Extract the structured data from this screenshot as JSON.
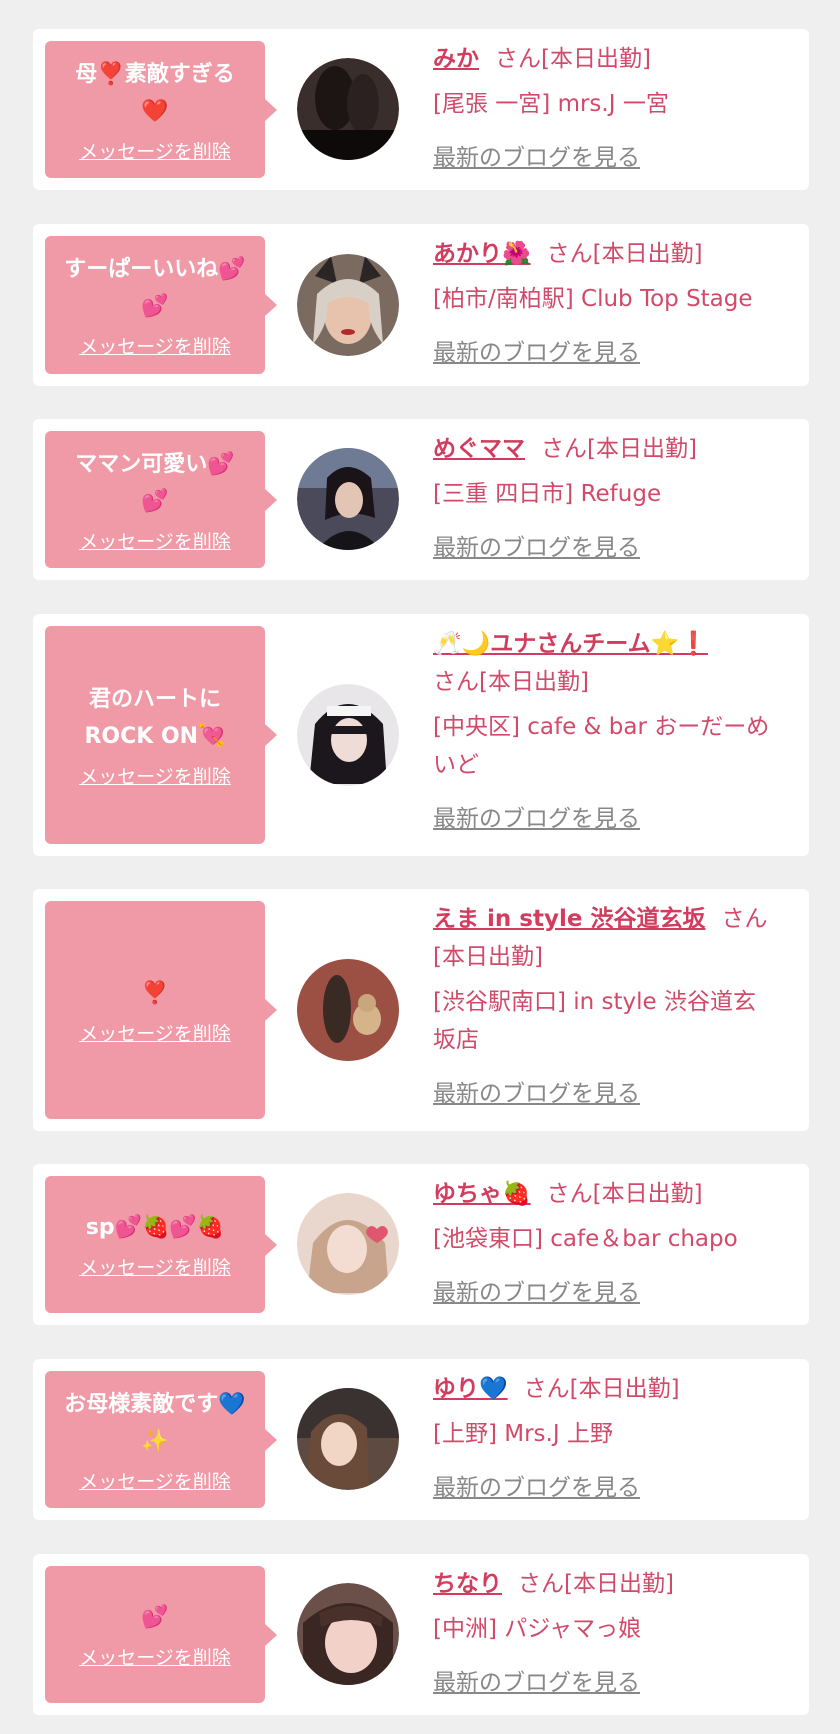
{
  "ui": {
    "delete_label": "メッセージを削除",
    "san_suffix": "さん[本日出勤]",
    "blog_label": "最新のブログを見る"
  },
  "colors": {
    "background": "#efefef",
    "card": "#ffffff",
    "bubble": "#ef9aa6",
    "name": "#d23c5e",
    "shop": "#d24a6a",
    "blog_link": "#888888"
  },
  "entries": [
    {
      "message_lines": [
        "母❣️素敵すぎる",
        "❤️"
      ],
      "name": "みか",
      "shop_lines": [
        "[尾張 一宮] mrs.J 一宮"
      ],
      "avatar_tone": "#3a2e2c"
    },
    {
      "message_lines": [
        "すーぱーいいね💕",
        "💕"
      ],
      "name": "あかり🌺",
      "shop_lines": [
        "[柏市/南柏駅] Club Top Stage"
      ],
      "avatar_tone": "#7a6a60"
    },
    {
      "message_lines": [
        "ママン可愛い💕",
        "💕"
      ],
      "name": "めぐママ",
      "shop_lines": [
        "[三重 四日市] Refuge"
      ],
      "avatar_tone": "#4a4a5a"
    },
    {
      "message_lines": [
        "君のハートに",
        "ROCK ON💘"
      ],
      "name": "🥂🌙ユナさんチーム⭐️❗️",
      "shop_lines": [
        "[中央区] cafe & bar おーだーめ",
        "いど"
      ],
      "avatar_tone": "#2e2a30"
    },
    {
      "message_lines": [
        "❣️"
      ],
      "name": "えま in style 渋谷道玄坂",
      "shop_lines": [
        "[渋谷駅南口] in style 渋谷道玄",
        "坂店"
      ],
      "avatar_tone": "#7a4a3c"
    },
    {
      "message_lines": [
        "sp💕🍓💕🍓"
      ],
      "name": "ゆちゃ🍓",
      "shop_lines": [
        "[池袋東口] cafe＆bar chapo"
      ],
      "avatar_tone": "#c9a48c"
    },
    {
      "message_lines": [
        "お母様素敵です💙",
        "✨"
      ],
      "name": "ゆり💙",
      "shop_lines": [
        "[上野] Mrs.J 上野"
      ],
      "avatar_tone": "#5e4a40"
    },
    {
      "message_lines": [
        "💕"
      ],
      "name": "ちなり",
      "shop_lines": [
        "[中洲] パジャマっ娘"
      ],
      "avatar_tone": "#6a5048"
    }
  ]
}
